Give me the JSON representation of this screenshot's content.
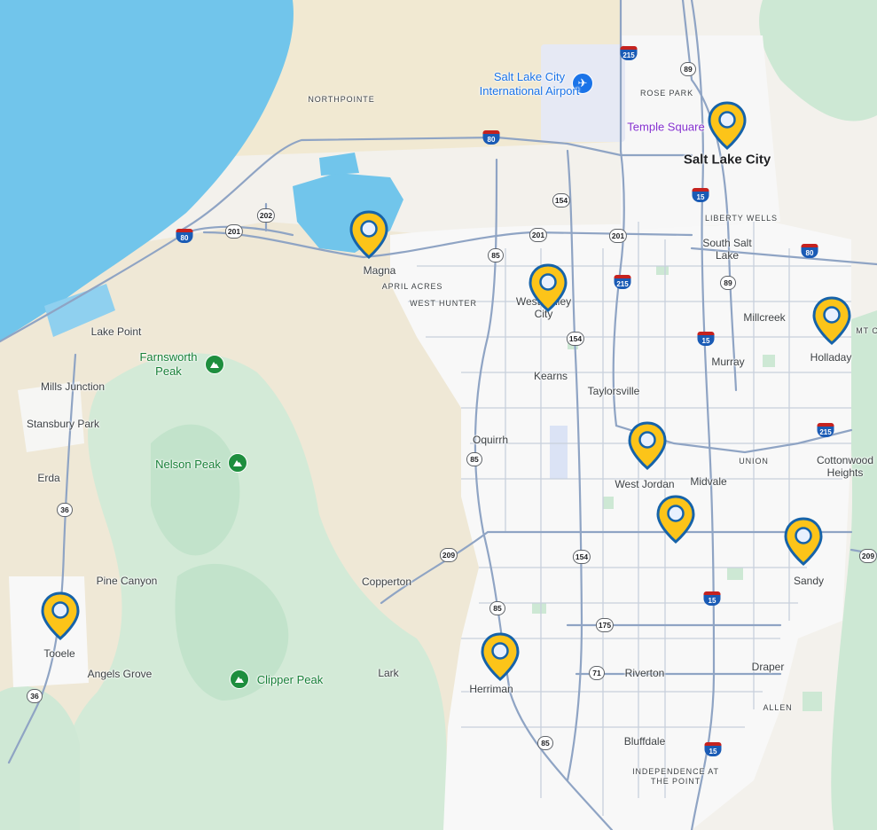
{
  "colors": {
    "water": "#71c5eb",
    "land": "#f3f1ec",
    "desert": "#f1e8cf",
    "vegetation": "#cde8d4",
    "urban": "#f8f8f8",
    "highway": "#8fa4c4",
    "arterial": "#b7c2d4",
    "park_green": "#1e8e3e",
    "airport_blue": "#1a73e8",
    "poi_purple": "#8430ce",
    "pin_fill": "#fcc419",
    "pin_stroke": "#1663a9"
  },
  "labels": {
    "salt_lake_city": "Salt Lake City",
    "temple_square": "Temple Square",
    "airport_name": "Salt Lake City International Airport",
    "northpointe": "NORTHPOINTE",
    "rose_park": "ROSE PARK",
    "liberty_wells": "LIBERTY WELLS",
    "south_salt_lake": "South Salt Lake",
    "magna": "Magna",
    "april_acres": "APRIL ACRES",
    "west_hunter": "WEST HUNTER",
    "west_valley_city": "West Valley City",
    "millcreek": "Millcreek",
    "holladay": "Holladay",
    "mt_partial": "MT C",
    "murray": "Murray",
    "kearns": "Kearns",
    "taylorsville": "Taylorsville",
    "lake_point": "Lake Point",
    "farnsworth_peak": "Farnsworth Peak",
    "mills_junction": "Mills Junction",
    "stansbury_park": "Stansbury Park",
    "oquirrh": "Oquirrh",
    "nelson_peak": "Nelson Peak",
    "union": "UNION",
    "cottonwood_heights": "Cottonwood Heights",
    "erda": "Erda",
    "west_jordan": "West Jordan",
    "midvale": "Midvale",
    "sandy": "Sandy",
    "pine_canyon": "Pine Canyon",
    "copperton": "Copperton",
    "tooele": "Tooele",
    "angels_grove": "Angels Grove",
    "clipper_peak": "Clipper Peak",
    "lark": "Lark",
    "herriman": "Herriman",
    "riverton": "Riverton",
    "draper": "Draper",
    "allen": "ALLEN",
    "bluffdale": "Bluffdale",
    "independence_at_the_point": "INDEPENDENCE AT THE POINT"
  },
  "shields": {
    "i215_north": "215",
    "i215_mid": "215",
    "i215_south": "215",
    "i80_west": "80",
    "i80_mid": "80",
    "i80_east": "80",
    "i15_north": "15",
    "i15_murray": "15",
    "i15_sandy": "15",
    "i15_bluffdale": "15",
    "us89_north": "89",
    "us89_mid": "89",
    "sr202": "202",
    "sr201_west": "201",
    "sr201_mid": "201",
    "sr201_east": "201",
    "sr154_north": "154",
    "sr154_mid": "154",
    "sr154_south": "154",
    "sr85_north": "85",
    "sr85_mid": "85",
    "sr85_south": "85",
    "sr85_bottom": "85",
    "sr36_north": "36",
    "sr36_south": "36",
    "sr209_west": "209",
    "sr209_east": "209",
    "sr175": "175",
    "sr71": "71"
  },
  "markers": [
    {
      "name": "marker-salt-lake-city",
      "place": "Salt Lake City"
    },
    {
      "name": "marker-magna",
      "place": "Magna"
    },
    {
      "name": "marker-west-valley-city",
      "place": "West Valley City"
    },
    {
      "name": "marker-holladay",
      "place": "Holladay"
    },
    {
      "name": "marker-west-jordan",
      "place": "West Jordan"
    },
    {
      "name": "marker-midvale",
      "place": "Midvale"
    },
    {
      "name": "marker-sandy",
      "place": "Sandy"
    },
    {
      "name": "marker-tooele",
      "place": "Tooele"
    },
    {
      "name": "marker-herriman",
      "place": "Herriman"
    }
  ]
}
